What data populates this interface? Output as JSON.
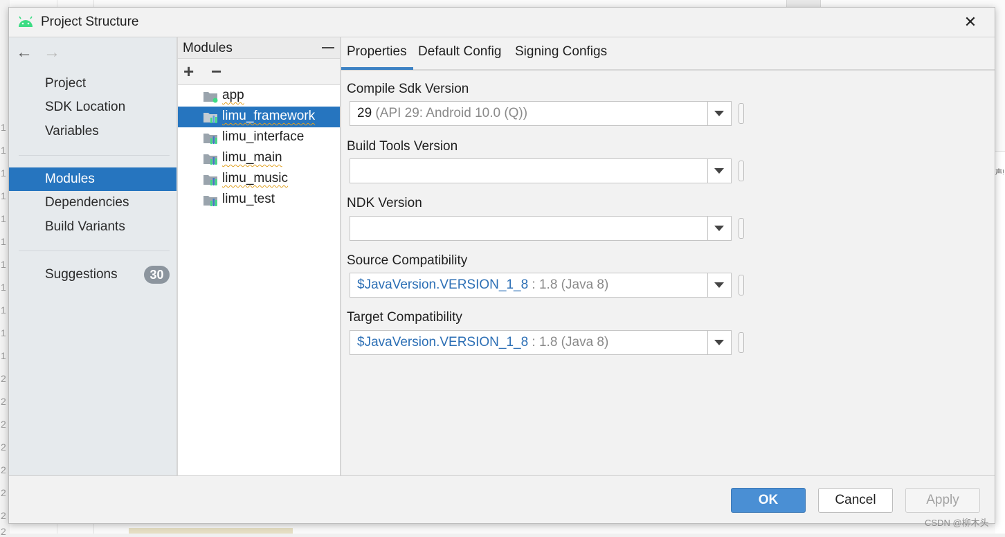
{
  "dialog": {
    "title": "Project Structure",
    "close_glyph": "✕"
  },
  "navigation": {
    "back_glyph": "←",
    "forward_glyph": "→",
    "items": [
      {
        "label": "Project"
      },
      {
        "label": "SDK Location"
      },
      {
        "label": "Variables"
      },
      {
        "label": "Modules"
      },
      {
        "label": "Dependencies"
      },
      {
        "label": "Build Variants"
      },
      {
        "label": "Suggestions"
      }
    ],
    "selected": "Modules",
    "suggestions_count": "30"
  },
  "modules_panel": {
    "title": "Modules",
    "add_glyph": "+",
    "remove_glyph": "−",
    "modules": [
      {
        "label": "app",
        "icon": "app-module-icon"
      },
      {
        "label": "limu_framework",
        "icon": "library-module-icon"
      },
      {
        "label": "limu_interface",
        "icon": "library-module-icon"
      },
      {
        "label": "limu_main",
        "icon": "library-module-icon"
      },
      {
        "label": "limu_music",
        "icon": "library-module-icon"
      },
      {
        "label": "limu_test",
        "icon": "library-module-icon"
      }
    ],
    "selected": "limu_framework"
  },
  "tabs": [
    {
      "label": "Properties"
    },
    {
      "label": "Default Config"
    },
    {
      "label": "Signing Configs"
    }
  ],
  "active_tab": "Properties",
  "fields": {
    "compile_sdk": {
      "label": "Compile Sdk Version",
      "value": "29",
      "hint": "(API 29: Android 10.0 (Q))"
    },
    "build_tools": {
      "label": "Build Tools Version",
      "value": ""
    },
    "ndk": {
      "label": "NDK Version",
      "value": ""
    },
    "source_compat": {
      "label": "Source Compatibility",
      "value": "$JavaVersion.VERSION_1_8",
      "hint": ": 1.8 (Java 8)"
    },
    "target_compat": {
      "label": "Target Compatibility",
      "value": "$JavaVersion.VERSION_1_8",
      "hint": ": 1.8 (Java 8)"
    }
  },
  "buttons": {
    "ok": "OK",
    "cancel": "Cancel",
    "apply": "Apply"
  },
  "background": {
    "gutter_numbers": [
      "1",
      "1",
      "1",
      "1",
      "1",
      "1",
      "1",
      "1",
      "1",
      "1",
      "1",
      "2",
      "2",
      "2",
      "2",
      "2",
      "2",
      "2",
      "2"
    ],
    "right_edge_text": "声!",
    "watermark": "CSDN @柳木头"
  },
  "colors": {
    "accent": "#2675bf",
    "ok_button": "#4a8fd4",
    "java_variable": "#2c6fb5",
    "badge": "#8c959e",
    "android_green": "#3ddc84"
  }
}
